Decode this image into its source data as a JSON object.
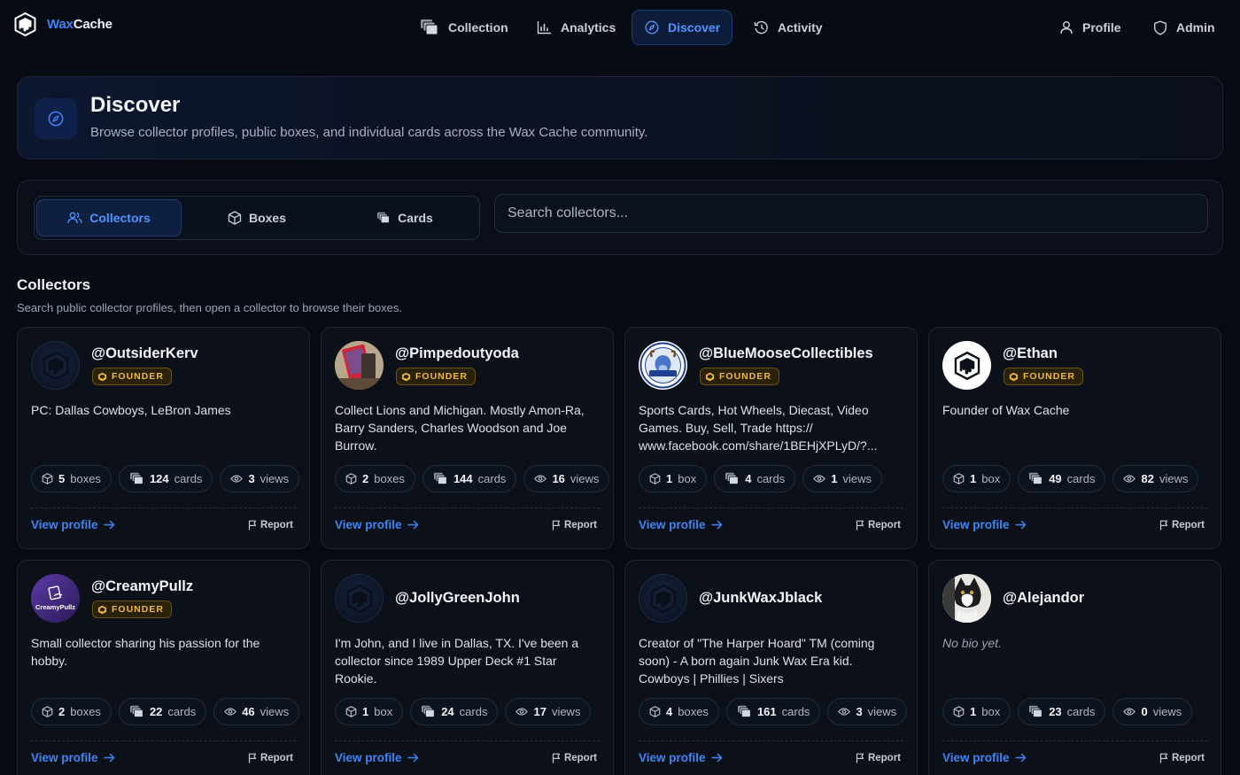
{
  "app": {
    "brand_wax": "Wax",
    "brand_cache": "Cache"
  },
  "nav": {
    "collection": "Collection",
    "analytics": "Analytics",
    "discover": "Discover",
    "activity": "Activity",
    "profile": "Profile",
    "admin": "Admin",
    "active": "Discover"
  },
  "hero": {
    "title": "Discover",
    "subtitle": "Browse collector profiles, public boxes, and individual cards across the Wax Cache community."
  },
  "tabs": {
    "collectors": "Collectors",
    "boxes": "Boxes",
    "cards": "Cards",
    "active": "Collectors"
  },
  "search": {
    "placeholder": "Search collectors..."
  },
  "section": {
    "title": "Collectors",
    "subtitle": "Search public collector profiles, then open a collector to browse their boxes."
  },
  "badge_label": "FOUNDER",
  "view_profile_label": "View profile",
  "report_label": "Report",
  "stat_units": {
    "views": "views"
  },
  "collectors": [
    {
      "username": "@OutsiderKerv",
      "founder": true,
      "avatar": "default-logo",
      "bio": "PC: Dallas Cowboys, LeBron James",
      "boxes": "5",
      "boxes_unit": "boxes",
      "cards": "124",
      "cards_unit": "cards",
      "views": "3"
    },
    {
      "username": "@Pimpedoutyoda",
      "founder": true,
      "avatar": "photo-card",
      "bio": "Collect Lions and Michigan. Mostly Amon-Ra, Barry Sanders, Charles Woodson and Joe Burrow.",
      "boxes": "2",
      "boxes_unit": "boxes",
      "cards": "144",
      "cards_unit": "cards",
      "views": "16"
    },
    {
      "username": "@BlueMooseCollectibles",
      "founder": true,
      "avatar": "blue-moose-logo",
      "bio": "Sports Cards, Hot Wheels, Diecast, Video Games. Buy, Sell, Trade https:// www.facebook.com/share/1BEHjXPLyD/?...",
      "boxes": "1",
      "boxes_unit": "box",
      "cards": "4",
      "cards_unit": "cards",
      "views": "1"
    },
    {
      "username": "@Ethan",
      "founder": true,
      "avatar": "white-logo",
      "bio": "Founder of Wax Cache",
      "boxes": "1",
      "boxes_unit": "box",
      "cards": "49",
      "cards_unit": "cards",
      "views": "82"
    },
    {
      "username": "@CreamyPullz",
      "founder": true,
      "avatar": "creamypullz-logo",
      "avatar_text": "CreamyPullz",
      "bio": "Small collector sharing his passion for the hobby.",
      "boxes": "2",
      "boxes_unit": "boxes",
      "cards": "22",
      "cards_unit": "cards",
      "views": "46"
    },
    {
      "username": "@JollyGreenJohn",
      "founder": false,
      "avatar": "default-logo",
      "bio": "I'm John, and I live in Dallas, TX. I've been a collector since 1989 Upper Deck #1 Star Rookie.",
      "boxes": "1",
      "boxes_unit": "box",
      "cards": "24",
      "cards_unit": "cards",
      "views": "17"
    },
    {
      "username": "@JunkWaxJblack",
      "founder": false,
      "avatar": "default-logo",
      "bio": "Creator of \"The Harper Hoard\" TM (coming soon) - A born again Junk Wax Era kid. Cowboys | Phillies | Sixers",
      "boxes": "4",
      "boxes_unit": "boxes",
      "cards": "161",
      "cards_unit": "cards",
      "views": "3"
    },
    {
      "username": "@Alejandor",
      "founder": false,
      "avatar": "cat-photo",
      "bio": "No bio yet.",
      "bio_empty": true,
      "boxes": "1",
      "boxes_unit": "box",
      "cards": "23",
      "cards_unit": "cards",
      "views": "0"
    }
  ],
  "colors": {
    "accent": "#3b82f6",
    "background": "#070b14",
    "card": "#0b1019",
    "founder": "#f0b93a"
  }
}
